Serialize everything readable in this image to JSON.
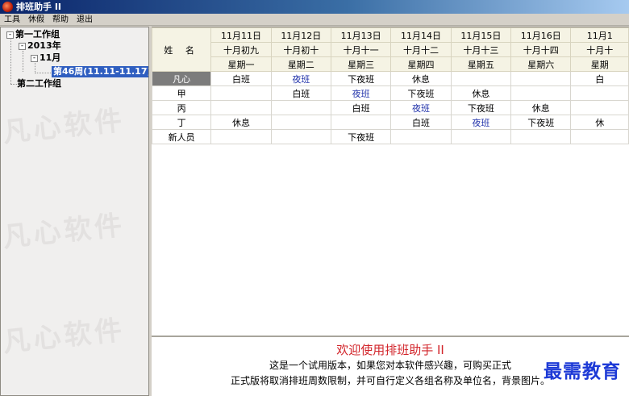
{
  "window": {
    "title": "排班助手 II"
  },
  "menu": [
    "工具",
    "休假",
    "帮助",
    "退出"
  ],
  "tree": {
    "group1": "第一工作组",
    "year": "2013年",
    "month": "11月",
    "week": "第46周(11.11-11.17)",
    "group2": "第二工作组",
    "watermark": "凡心软件"
  },
  "grid": {
    "name_header": "姓 名",
    "days": [
      {
        "date": "11月11日",
        "lunar": "十月初九",
        "weekday": "星期一"
      },
      {
        "date": "11月12日",
        "lunar": "十月初十",
        "weekday": "星期二"
      },
      {
        "date": "11月13日",
        "lunar": "十月十一",
        "weekday": "星期三"
      },
      {
        "date": "11月14日",
        "lunar": "十月十二",
        "weekday": "星期四"
      },
      {
        "date": "11月15日",
        "lunar": "十月十三",
        "weekday": "星期五"
      },
      {
        "date": "11月16日",
        "lunar": "十月十四",
        "weekday": "星期六"
      },
      {
        "date": "11月1",
        "lunar": "十月十",
        "weekday": "星期"
      }
    ],
    "rows": [
      {
        "name": "凡心",
        "shifts": [
          "白班",
          "夜班",
          "下夜班",
          "休息",
          "",
          "",
          "白"
        ]
      },
      {
        "name": "甲",
        "shifts": [
          "",
          "白班",
          "夜班",
          "下夜班",
          "休息",
          "",
          ""
        ]
      },
      {
        "name": "丙",
        "shifts": [
          "",
          "",
          "白班",
          "夜班",
          "下夜班",
          "休息",
          ""
        ]
      },
      {
        "name": "丁",
        "shifts": [
          "休息",
          "",
          "",
          "白班",
          "夜班",
          "下夜班",
          "休"
        ]
      },
      {
        "name": "新人员",
        "shifts": [
          "",
          "",
          "下夜班",
          "",
          "",
          "",
          ""
        ]
      }
    ]
  },
  "notice": {
    "title": "欢迎使用排班助手 II",
    "line1": "这是一个试用版本，如果您对本软件感兴趣，可购买正式",
    "line2": "正式版将取消排班周数限制，并可自行定义各组名称及单位名，背景图片。",
    "brand_watermark": "最需教育"
  }
}
